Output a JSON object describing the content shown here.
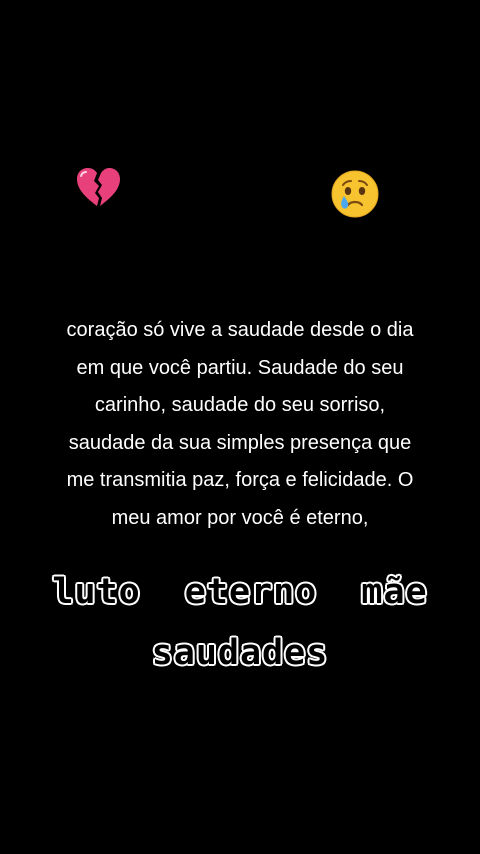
{
  "emojis": {
    "left": "broken-heart-icon",
    "right": "crying-face-icon"
  },
  "body_text": {
    "lines": [
      "coração só vive a saudade desde o dia",
      "em que você partiu. Saudade do seu",
      "carinho, saudade do seu sorriso,",
      "saudade da sua simples presença que",
      "me transmitia paz, força e felicidade. O",
      "meu amor por você é eterno,"
    ]
  },
  "caption": {
    "line1": "luto  eterno  mãe",
    "line2": "saudades"
  },
  "colors": {
    "background": "#000000",
    "text": "#ffffff",
    "heart": "#e8407a"
  }
}
